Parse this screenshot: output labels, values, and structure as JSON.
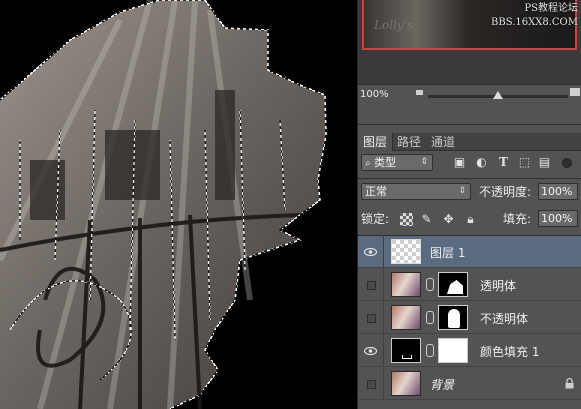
{
  "navigator": {
    "thumbnail_hint": "Lolly's",
    "watermark_line1": "PS教程论坛",
    "watermark_line2": "BBS.16XX8.COM",
    "accent_color": "#e03a3a"
  },
  "zoom": {
    "value": "100%",
    "slider_level": 0.5
  },
  "layers_panel": {
    "tabs": [
      {
        "label": "图层",
        "active": true
      },
      {
        "label": "路径",
        "active": false
      },
      {
        "label": "通道",
        "active": false
      }
    ],
    "filter": {
      "label": "类型",
      "icon": "search-icon"
    },
    "filter_icons": [
      "image-filter-icon",
      "adjustment-filter-icon",
      "type-filter-icon",
      "shape-filter-icon",
      "smart-object-filter-icon"
    ],
    "blend_mode": "正常",
    "opacity_label": "不透明度:",
    "opacity_value": "100%",
    "lock_label": "锁定:",
    "lock_icons": [
      "lock-transparent-icon",
      "lock-image-icon",
      "lock-position-icon",
      "lock-all-icon"
    ],
    "fill_label": "填充:",
    "fill_value": "100%",
    "layers": [
      {
        "name": "图层 1",
        "visible": true,
        "selected": true,
        "thumb": "transparent"
      },
      {
        "name": "透明体",
        "visible": false,
        "selected": false,
        "thumb": "photo",
        "mask": "black-with-white-shape"
      },
      {
        "name": "不透明体",
        "visible": false,
        "selected": false,
        "thumb": "photo",
        "mask": "black-with-white-figure"
      },
      {
        "name": "颜色填充 1",
        "visible": true,
        "selected": false,
        "thumb": "black-fill",
        "mask": "white"
      },
      {
        "name": "背景",
        "visible": false,
        "selected": false,
        "thumb": "photo",
        "locked": true,
        "italic": true
      }
    ]
  }
}
